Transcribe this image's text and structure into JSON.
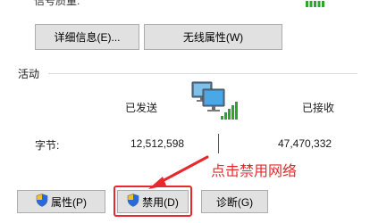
{
  "connection": {
    "signal_quality_label": "信号质量:"
  },
  "buttons": {
    "details": "详细信息(E)...",
    "wireless_properties": "无线属性(W)",
    "properties": "属性(P)",
    "disable": "禁用(D)",
    "diagnose": "诊断(G)"
  },
  "activity": {
    "section_label": "活动",
    "sent_label": "已发送",
    "received_label": "已接收",
    "bytes_label": "字节:",
    "bytes_sent": "12,512,598",
    "bytes_received": "47,470,332"
  },
  "annotation": {
    "text": "点击禁用网络",
    "color": "#e8282d"
  },
  "icons": {
    "network": "network-computers-icon",
    "signal": "signal-bars-icon",
    "shield": "uac-shield-icon"
  }
}
